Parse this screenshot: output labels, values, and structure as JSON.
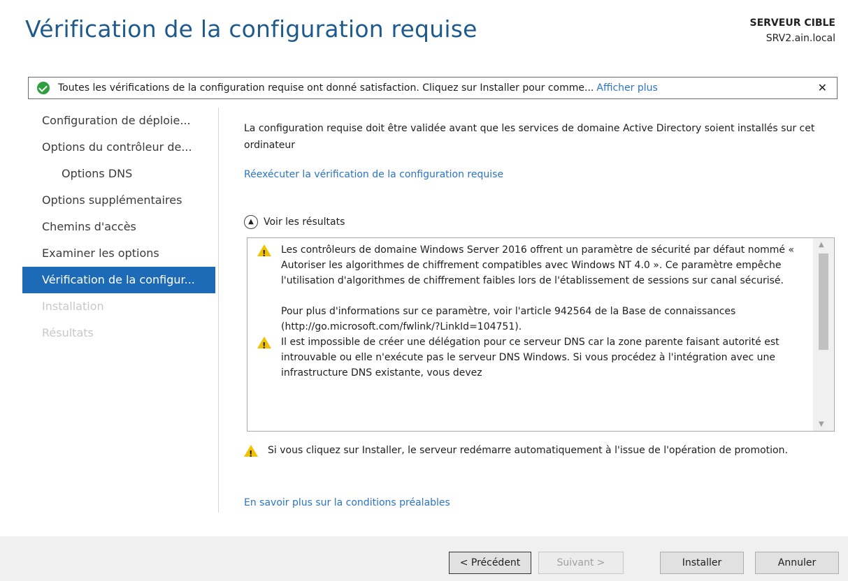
{
  "header": {
    "title": "Vérification de la configuration requise",
    "target_label": "SERVEUR CIBLE",
    "target_value": "SRV2.ain.local"
  },
  "notification": {
    "message": "Toutes les vérifications de la configuration requise ont donné satisfaction. Cliquez sur Installer pour comme...",
    "more_link": "Afficher plus",
    "close_glyph": "✕"
  },
  "nav": {
    "items": [
      {
        "label": "Configuration de déploie...",
        "state": "normal"
      },
      {
        "label": "Options du contrôleur de...",
        "state": "normal"
      },
      {
        "label": "Options DNS",
        "state": "sub"
      },
      {
        "label": "Options supplémentaires",
        "state": "normal"
      },
      {
        "label": "Chemins d'accès",
        "state": "normal"
      },
      {
        "label": "Examiner les options",
        "state": "normal"
      },
      {
        "label": "Vérification de la configur...",
        "state": "active"
      },
      {
        "label": "Installation",
        "state": "disabled"
      },
      {
        "label": "Résultats",
        "state": "disabled"
      }
    ]
  },
  "main": {
    "intro": "La configuration requise doit être validée avant que les services de domaine Active Directory soient installés sur cet ordinateur",
    "rerun_link": "Réexécuter la vérification de la configuration requise",
    "results_toggle": "Voir les résultats",
    "results": [
      {
        "p1": "Les contrôleurs de domaine Windows Server 2016 offrent un paramètre de sécurité par défaut nommé « Autoriser les algorithmes de chiffrement compatibles avec Windows NT 4.0 ». Ce paramètre empêche l'utilisation d'algorithmes de chiffrement faibles lors de l'établissement de sessions sur canal sécurisé.",
        "p2": "Pour plus d'informations sur ce paramètre, voir l'article 942564 de la Base de connaissances (http://go.microsoft.com/fwlink/?LinkId=104751)."
      },
      {
        "p1": "Il est impossible de créer une délégation pour ce serveur DNS car la zone parente faisant autorité est introuvable ou elle n'exécute pas le serveur DNS Windows. Si vous procédez à l'intégration avec une infrastructure DNS existante, vous devez",
        "p2": ""
      }
    ],
    "restart_note": "Si vous cliquez sur Installer, le serveur redémarre automatiquement à l'issue de l'opération de promotion.",
    "learn_link": "En savoir plus sur la conditions préalables"
  },
  "footer": {
    "prev": "< Précédent",
    "next": "Suivant >",
    "install": "Installer",
    "cancel": "Annuler"
  },
  "colors": {
    "title": "#1f5a8c",
    "link": "#2b74c5",
    "active_nav": "#1d6bb6",
    "success": "#2f9e3e",
    "warning": "#f2c200"
  }
}
